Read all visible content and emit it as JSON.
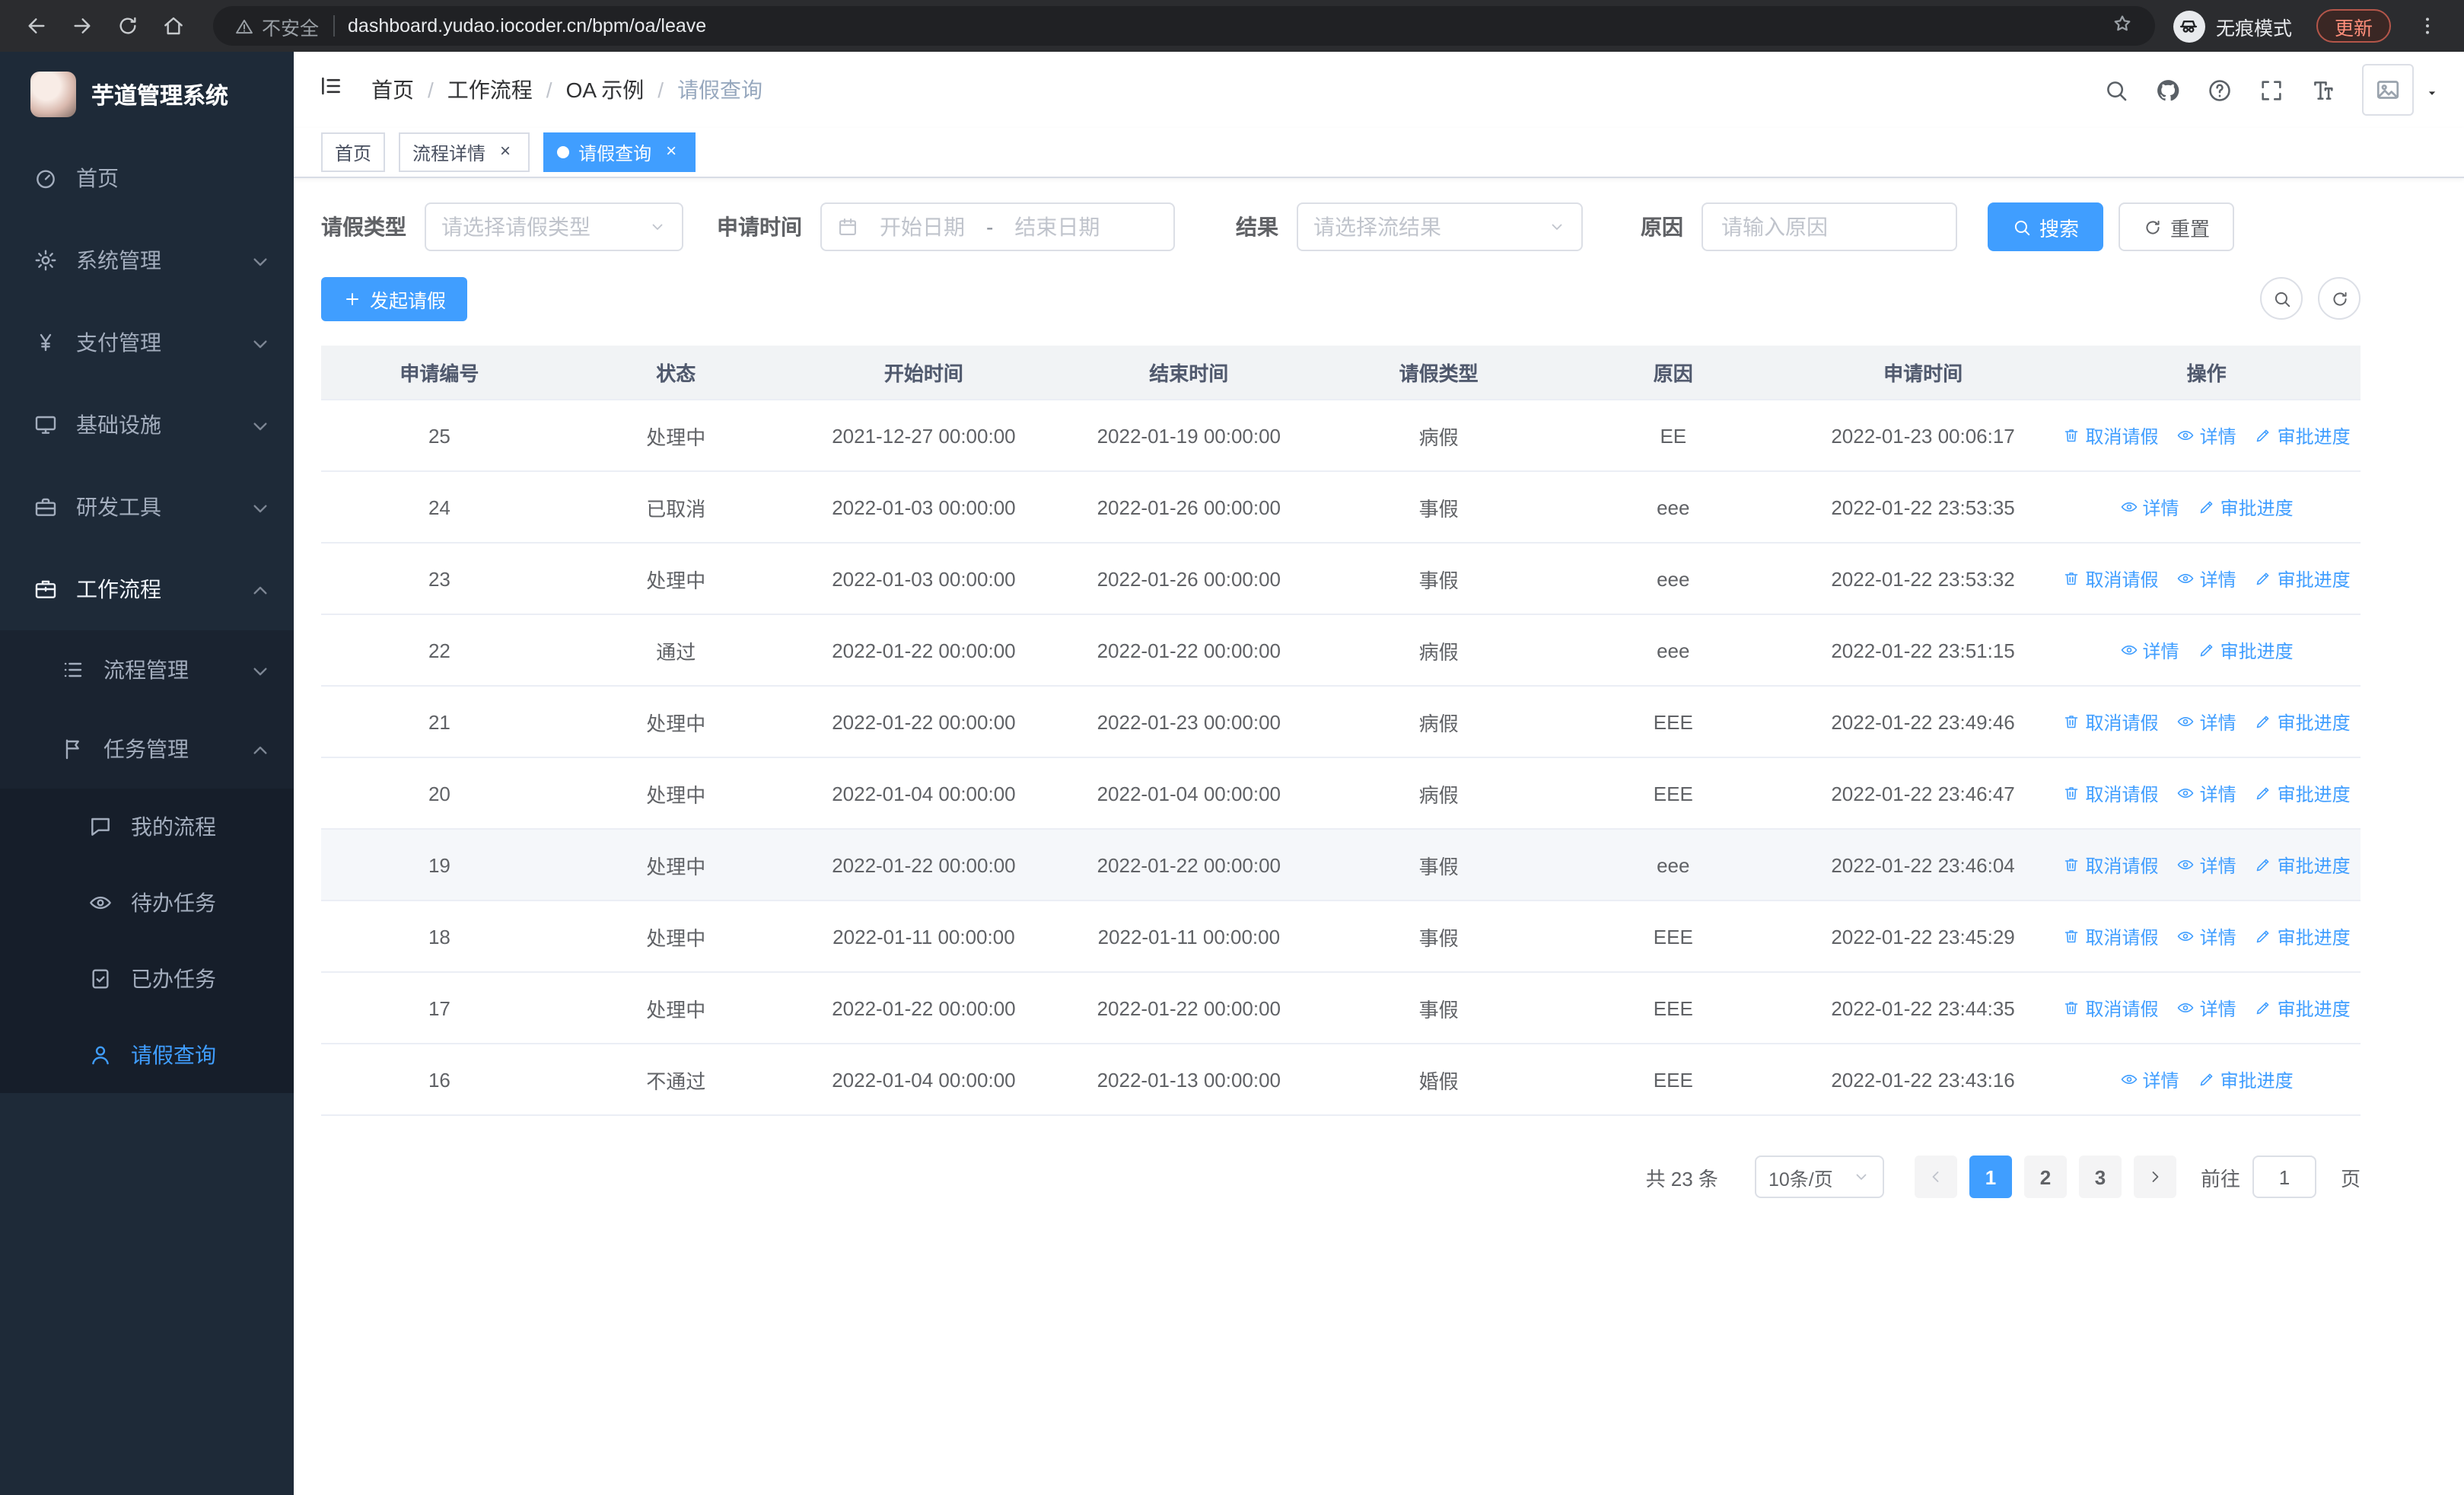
{
  "browser": {
    "url": "dashboard.yudao.iocoder.cn/bpm/oa/leave",
    "security_label": "不安全",
    "incognito_label": "无痕模式",
    "update_label": "更新"
  },
  "sidebar": {
    "app_title": "芋道管理系统",
    "items": [
      {
        "key": "home",
        "label": "首页",
        "icon": "gauge-icon",
        "level": 1
      },
      {
        "key": "system-mgmt",
        "label": "系统管理",
        "icon": "gear-icon",
        "level": 1,
        "chevron": "down"
      },
      {
        "key": "payment-mgmt",
        "label": "支付管理",
        "icon": "yen-icon",
        "level": 1,
        "chevron": "down"
      },
      {
        "key": "infrastructure",
        "label": "基础设施",
        "icon": "monitor-icon",
        "level": 1,
        "chevron": "down"
      },
      {
        "key": "dev-tools",
        "label": "研发工具",
        "icon": "toolbox-icon",
        "level": 1,
        "chevron": "down"
      },
      {
        "key": "workflow",
        "label": "工作流程",
        "icon": "briefcase-icon",
        "level": 1,
        "chevron": "up",
        "open": true
      },
      {
        "key": "process-mgmt",
        "label": "流程管理",
        "icon": "list-icon",
        "level": 2,
        "chevron": "down"
      },
      {
        "key": "task-mgmt",
        "label": "任务管理",
        "icon": "flag-icon",
        "level": 2,
        "chevron": "up"
      },
      {
        "key": "my-process",
        "label": "我的流程",
        "icon": "chat-icon",
        "level": 3
      },
      {
        "key": "todo-tasks",
        "label": "待办任务",
        "icon": "eye-icon",
        "level": 3
      },
      {
        "key": "done-tasks",
        "label": "已办任务",
        "icon": "clipboard-check-icon",
        "level": 3
      },
      {
        "key": "leave-query",
        "label": "请假查询",
        "icon": "user-icon",
        "level": 3,
        "active": true
      }
    ]
  },
  "header": {
    "breadcrumb": [
      "首页",
      "工作流程",
      "OA 示例",
      "请假查询"
    ]
  },
  "tabs": [
    {
      "key": "home",
      "label": "首页",
      "closable": false,
      "active": false
    },
    {
      "key": "process-detail",
      "label": "流程详情",
      "closable": true,
      "active": false
    },
    {
      "key": "leave-query",
      "label": "请假查询",
      "closable": true,
      "active": true
    }
  ],
  "filters": {
    "leave_type_label": "请假类型",
    "leave_type_placeholder": "请选择请假类型",
    "apply_time_label": "申请时间",
    "start_date_placeholder": "开始日期",
    "range_separator": "-",
    "end_date_placeholder": "结束日期",
    "result_label": "结果",
    "result_placeholder": "请选择流结果",
    "reason_label": "原因",
    "reason_placeholder": "请输入原因",
    "search_label": "搜索",
    "reset_label": "重置"
  },
  "toolbar": {
    "create_label": "发起请假"
  },
  "table": {
    "columns": [
      "申请编号",
      "状态",
      "开始时间",
      "结束时间",
      "请假类型",
      "原因",
      "申请时间",
      "操作"
    ],
    "op_defs": {
      "cancel": {
        "label": "取消请假",
        "icon": "trash-icon"
      },
      "detail": {
        "label": "详情",
        "icon": "eye-icon"
      },
      "progress": {
        "label": "审批进度",
        "icon": "edit-icon"
      }
    },
    "rows": [
      {
        "apply_id": "25",
        "status": "处理中",
        "start_time": "2021-12-27 00:00:00",
        "end_time": "2022-01-19 00:00:00",
        "leave_type": "病假",
        "reason": "EE",
        "apply_time": "2022-01-23 00:06:17",
        "ops": [
          "cancel",
          "detail",
          "progress"
        ],
        "highlight": false
      },
      {
        "apply_id": "24",
        "status": "已取消",
        "start_time": "2022-01-03 00:00:00",
        "end_time": "2022-01-26 00:00:00",
        "leave_type": "事假",
        "reason": "eee",
        "apply_time": "2022-01-22 23:53:35",
        "ops": [
          "detail",
          "progress"
        ],
        "highlight": false
      },
      {
        "apply_id": "23",
        "status": "处理中",
        "start_time": "2022-01-03 00:00:00",
        "end_time": "2022-01-26 00:00:00",
        "leave_type": "事假",
        "reason": "eee",
        "apply_time": "2022-01-22 23:53:32",
        "ops": [
          "cancel",
          "detail",
          "progress"
        ],
        "highlight": false
      },
      {
        "apply_id": "22",
        "status": "通过",
        "start_time": "2022-01-22 00:00:00",
        "end_time": "2022-01-22 00:00:00",
        "leave_type": "病假",
        "reason": "eee",
        "apply_time": "2022-01-22 23:51:15",
        "ops": [
          "detail",
          "progress"
        ],
        "highlight": false
      },
      {
        "apply_id": "21",
        "status": "处理中",
        "start_time": "2022-01-22 00:00:00",
        "end_time": "2022-01-23 00:00:00",
        "leave_type": "病假",
        "reason": "EEE",
        "apply_time": "2022-01-22 23:49:46",
        "ops": [
          "cancel",
          "detail",
          "progress"
        ],
        "highlight": false
      },
      {
        "apply_id": "20",
        "status": "处理中",
        "start_time": "2022-01-04 00:00:00",
        "end_time": "2022-01-04 00:00:00",
        "leave_type": "病假",
        "reason": "EEE",
        "apply_time": "2022-01-22 23:46:47",
        "ops": [
          "cancel",
          "detail",
          "progress"
        ],
        "highlight": false
      },
      {
        "apply_id": "19",
        "status": "处理中",
        "start_time": "2022-01-22 00:00:00",
        "end_time": "2022-01-22 00:00:00",
        "leave_type": "事假",
        "reason": "eee",
        "apply_time": "2022-01-22 23:46:04",
        "ops": [
          "cancel",
          "detail",
          "progress"
        ],
        "highlight": true
      },
      {
        "apply_id": "18",
        "status": "处理中",
        "start_time": "2022-01-11 00:00:00",
        "end_time": "2022-01-11 00:00:00",
        "leave_type": "事假",
        "reason": "EEE",
        "apply_time": "2022-01-22 23:45:29",
        "ops": [
          "cancel",
          "detail",
          "progress"
        ],
        "highlight": false
      },
      {
        "apply_id": "17",
        "status": "处理中",
        "start_time": "2022-01-22 00:00:00",
        "end_time": "2022-01-22 00:00:00",
        "leave_type": "事假",
        "reason": "EEE",
        "apply_time": "2022-01-22 23:44:35",
        "ops": [
          "cancel",
          "detail",
          "progress"
        ],
        "highlight": false
      },
      {
        "apply_id": "16",
        "status": "不通过",
        "start_time": "2022-01-04 00:00:00",
        "end_time": "2022-01-13 00:00:00",
        "leave_type": "婚假",
        "reason": "EEE",
        "apply_time": "2022-01-22 23:43:16",
        "ops": [
          "detail",
          "progress"
        ],
        "highlight": false
      }
    ]
  },
  "pagination": {
    "total_label": "共 23 条",
    "page_size_label": "10条/页",
    "pages": [
      "1",
      "2",
      "3"
    ],
    "active_page": "1",
    "goto_label": "前往",
    "goto_value": "1",
    "page_suffix": "页"
  },
  "colors": {
    "primary": "#409eff",
    "sidebar_bg": "#1e2a38",
    "update_accent": "#ff8e7a"
  }
}
